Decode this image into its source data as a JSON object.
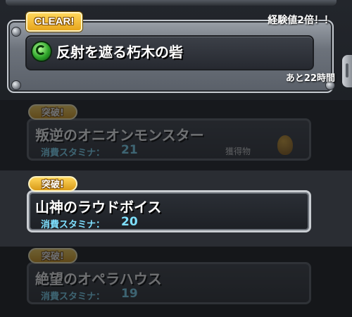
{
  "featured_quest": {
    "clear_badge": "CLEAR!",
    "exp_bonus": "経験値2倍！！",
    "title": "反射を遮る朽木の砦",
    "time_left": "あと22時間"
  },
  "quests": [
    {
      "badge": "突破!",
      "title": "叛逆のオニオンモンスター",
      "stamina_label": "消費スタミナ：",
      "stamina_value": "21",
      "drop_label": "獲得物",
      "state": "dimmed"
    },
    {
      "badge": "突破!",
      "title": "山神のラウドボイス",
      "stamina_label": "消費スタミナ：",
      "stamina_value": "20",
      "state": "selected"
    },
    {
      "badge": "突破!",
      "title": "絶望のオペラハウス",
      "stamina_label": "消費スタミナ：",
      "stamina_value": "19",
      "state": "dimmed"
    }
  ],
  "icons": {
    "element": "wood-element-orb-icon",
    "drop": "egg-icon"
  },
  "colors": {
    "badge_gold": "#e6a51c",
    "stamina_text": "#7fe0ff",
    "element_green": "#2ea52a"
  }
}
